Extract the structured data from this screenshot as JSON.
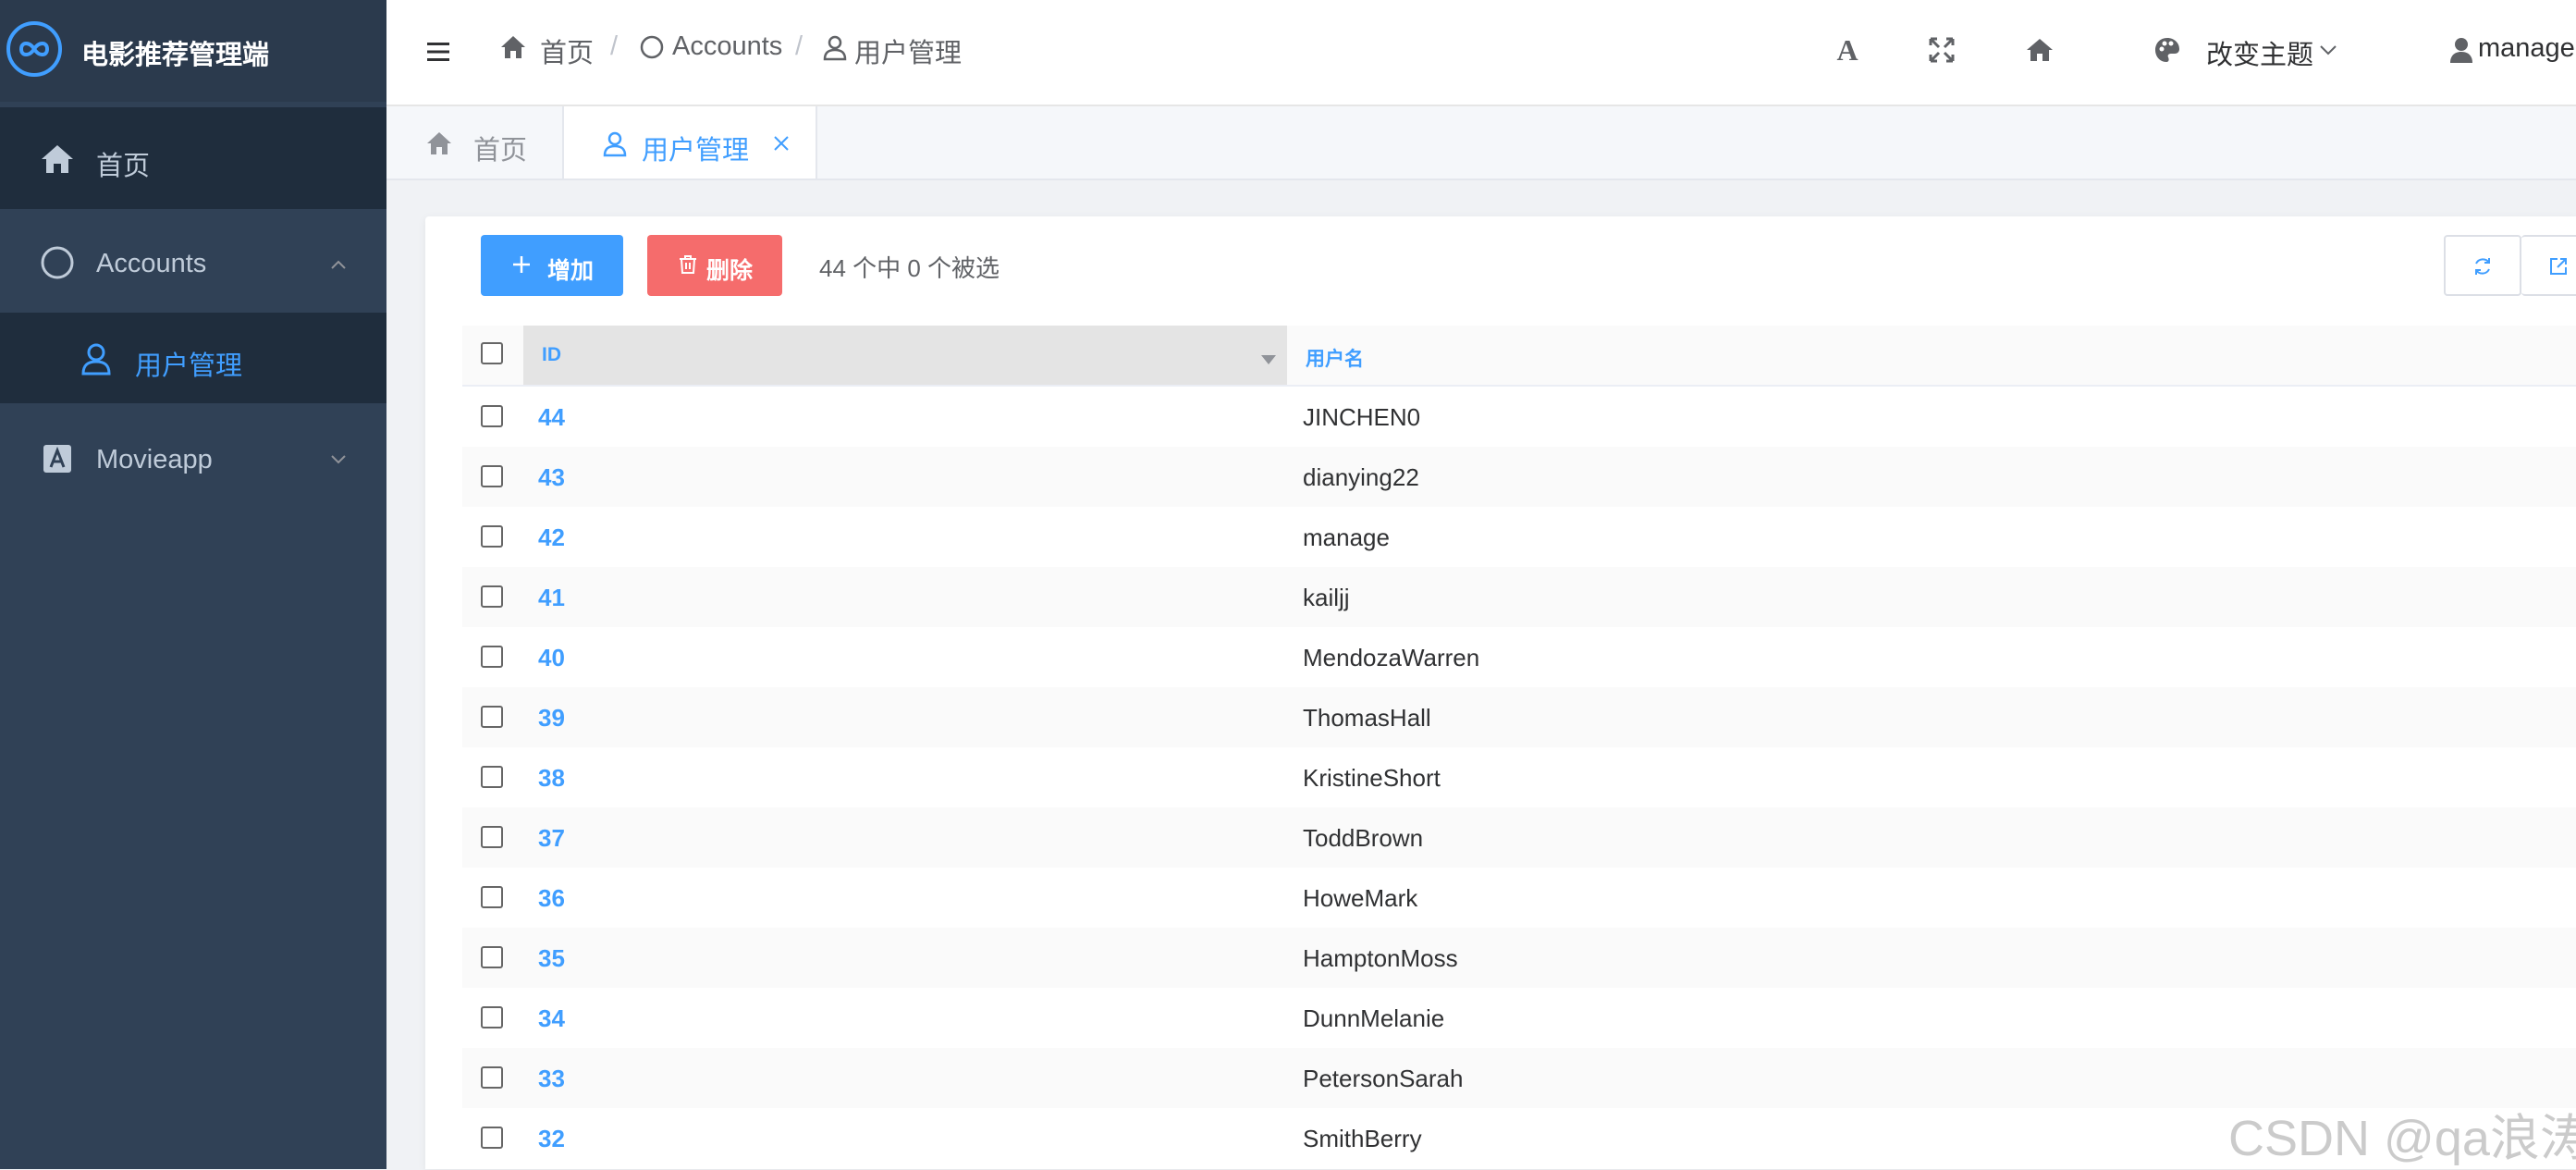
{
  "app": {
    "title": "电影推荐管理端"
  },
  "sidebar": {
    "items": [
      {
        "label": "首页",
        "icon": "home-icon"
      },
      {
        "label": "Accounts",
        "icon": "circle-icon",
        "expanded": true
      },
      {
        "label": "用户管理",
        "icon": "user-icon",
        "active": true
      },
      {
        "label": "Movieapp",
        "icon": "app-icon",
        "expanded": false
      }
    ]
  },
  "header": {
    "breadcrumb": [
      "首页",
      "Accounts",
      "用户管理"
    ],
    "breadcrumb_separator": "/",
    "font_icon_glyph": "A",
    "theme_label": "改变主题",
    "user_label": "manage"
  },
  "tabs": [
    {
      "label": "首页",
      "active": false
    },
    {
      "label": "用户管理",
      "active": true
    }
  ],
  "toolbar": {
    "add_label": "增加",
    "delete_label": "删除",
    "selection_text": "44 个中 0 个被选"
  },
  "table": {
    "columns": [
      "ID",
      "用户名"
    ],
    "rows": [
      {
        "id": "44",
        "username": "JINCHEN0"
      },
      {
        "id": "43",
        "username": "dianying22"
      },
      {
        "id": "42",
        "username": "manage"
      },
      {
        "id": "41",
        "username": "kailjj"
      },
      {
        "id": "40",
        "username": "MendozaWarren"
      },
      {
        "id": "39",
        "username": "ThomasHall"
      },
      {
        "id": "38",
        "username": "KristineShort"
      },
      {
        "id": "37",
        "username": "ToddBrown"
      },
      {
        "id": "36",
        "username": "HoweMark"
      },
      {
        "id": "35",
        "username": "HamptonMoss"
      },
      {
        "id": "34",
        "username": "DunnMelanie"
      },
      {
        "id": "33",
        "username": "PetersonSarah"
      },
      {
        "id": "32",
        "username": "SmithBerry"
      }
    ]
  },
  "watermark": "CSDN @qa浪涛",
  "colors": {
    "sidebar_bg": "#304156",
    "sidebar_active_bg": "#1f2d3d",
    "accent": "#409eff",
    "danger": "#f56c6c"
  }
}
